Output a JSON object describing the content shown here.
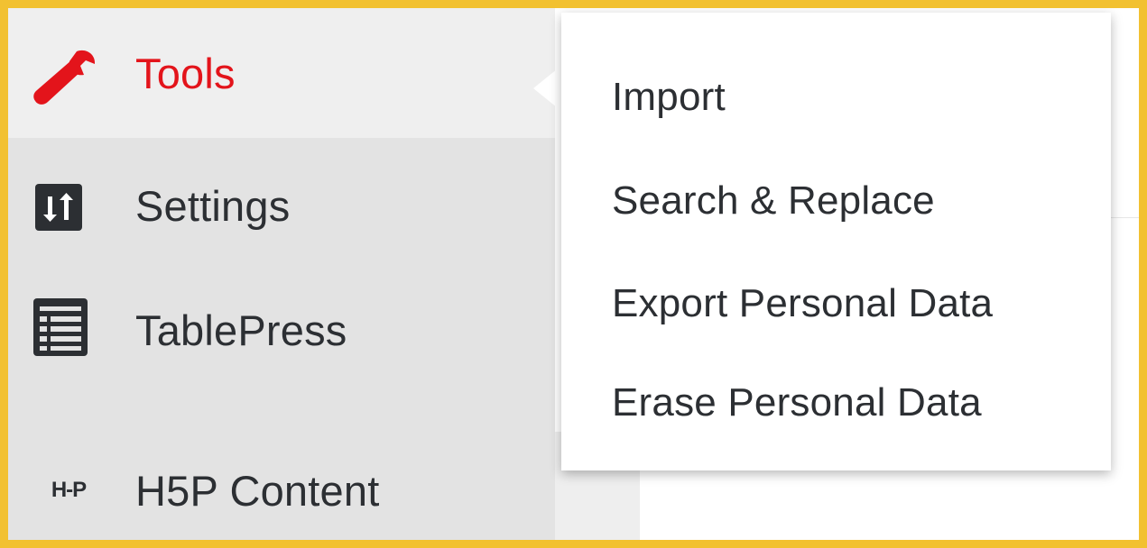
{
  "sidebar": {
    "items": [
      {
        "label": "Tools",
        "icon": "wrench-icon",
        "active": true
      },
      {
        "label": "Settings",
        "icon": "settings-sliders-icon",
        "active": false
      },
      {
        "label": "TablePress",
        "icon": "table-list-icon",
        "active": false
      },
      {
        "label": "H5P Content",
        "icon": "h5p-logo-icon",
        "icon_text": "H-P",
        "active": false
      }
    ]
  },
  "flyout": {
    "items": [
      {
        "label": "Import"
      },
      {
        "label": "Search & Replace"
      },
      {
        "label": "Export Personal Data"
      },
      {
        "label": "Erase Personal Data"
      }
    ]
  },
  "colors": {
    "highlight_border": "#f2c131",
    "active_text": "#e3141b",
    "menu_text": "#2c2f33",
    "sidebar_bg": "#e3e3e3",
    "active_bg": "#efefef"
  }
}
